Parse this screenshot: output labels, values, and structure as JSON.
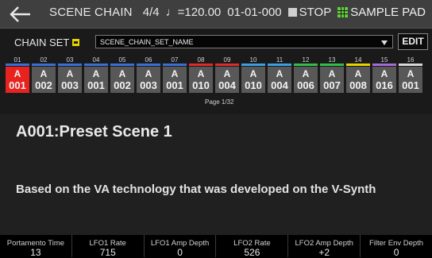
{
  "header": {
    "title": "SCENE CHAIN",
    "time_sig": "4/4",
    "tempo": "♩=120.00",
    "position": "01-01-000",
    "transport": "STOP",
    "sample_pad": "SAMPLE PAD"
  },
  "chain_set": {
    "label": "CHAIN SET",
    "name": "SCENE_CHAIN_SET_NAME",
    "edit_label": "EDIT"
  },
  "slots": [
    {
      "num": "01",
      "bank": "A",
      "scene": "001",
      "color": "#3a6fd8",
      "active": true
    },
    {
      "num": "02",
      "bank": "A",
      "scene": "002",
      "color": "#3a6fd8",
      "active": false
    },
    {
      "num": "03",
      "bank": "A",
      "scene": "003",
      "color": "#3a6fd8",
      "active": false
    },
    {
      "num": "04",
      "bank": "A",
      "scene": "001",
      "color": "#3a6fd8",
      "active": false
    },
    {
      "num": "05",
      "bank": "A",
      "scene": "002",
      "color": "#3a6fd8",
      "active": false
    },
    {
      "num": "06",
      "bank": "A",
      "scene": "003",
      "color": "#3a6fd8",
      "active": false
    },
    {
      "num": "07",
      "bank": "A",
      "scene": "001",
      "color": "#3a6fd8",
      "active": false
    },
    {
      "num": "08",
      "bank": "A",
      "scene": "010",
      "color": "#e02b2b",
      "active": false
    },
    {
      "num": "09",
      "bank": "A",
      "scene": "004",
      "color": "#e02b2b",
      "active": false
    },
    {
      "num": "10",
      "bank": "A",
      "scene": "010",
      "color": "#3aa0e0",
      "active": false
    },
    {
      "num": "11",
      "bank": "A",
      "scene": "004",
      "color": "#3aa0e0",
      "active": false
    },
    {
      "num": "12",
      "bank": "A",
      "scene": "006",
      "color": "#2fc04a",
      "active": false
    },
    {
      "num": "13",
      "bank": "A",
      "scene": "007",
      "color": "#2fc04a",
      "active": false
    },
    {
      "num": "14",
      "bank": "A",
      "scene": "008",
      "color": "#e6d400",
      "active": false
    },
    {
      "num": "15",
      "bank": "A",
      "scene": "016",
      "color": "#a86ad8",
      "active": false
    },
    {
      "num": "16",
      "bank": "A",
      "scene": "001",
      "color": "#d8d8d8",
      "active": false
    }
  ],
  "page_label": "Page 1/32",
  "scene": {
    "name": "A001:Preset Scene 1",
    "description": "Based on the VA technology that was developed on the V-Synth"
  },
  "params": [
    {
      "label": "Portamento Time",
      "value": "13"
    },
    {
      "label": "LFO1 Rate",
      "value": "715"
    },
    {
      "label": "LFO1 Amp Depth",
      "value": "0"
    },
    {
      "label": "LFO2 Rate",
      "value": "526"
    },
    {
      "label": "LFO2 Amp Depth",
      "value": "+2"
    },
    {
      "label": "Filter Env Depth",
      "value": "0"
    }
  ]
}
